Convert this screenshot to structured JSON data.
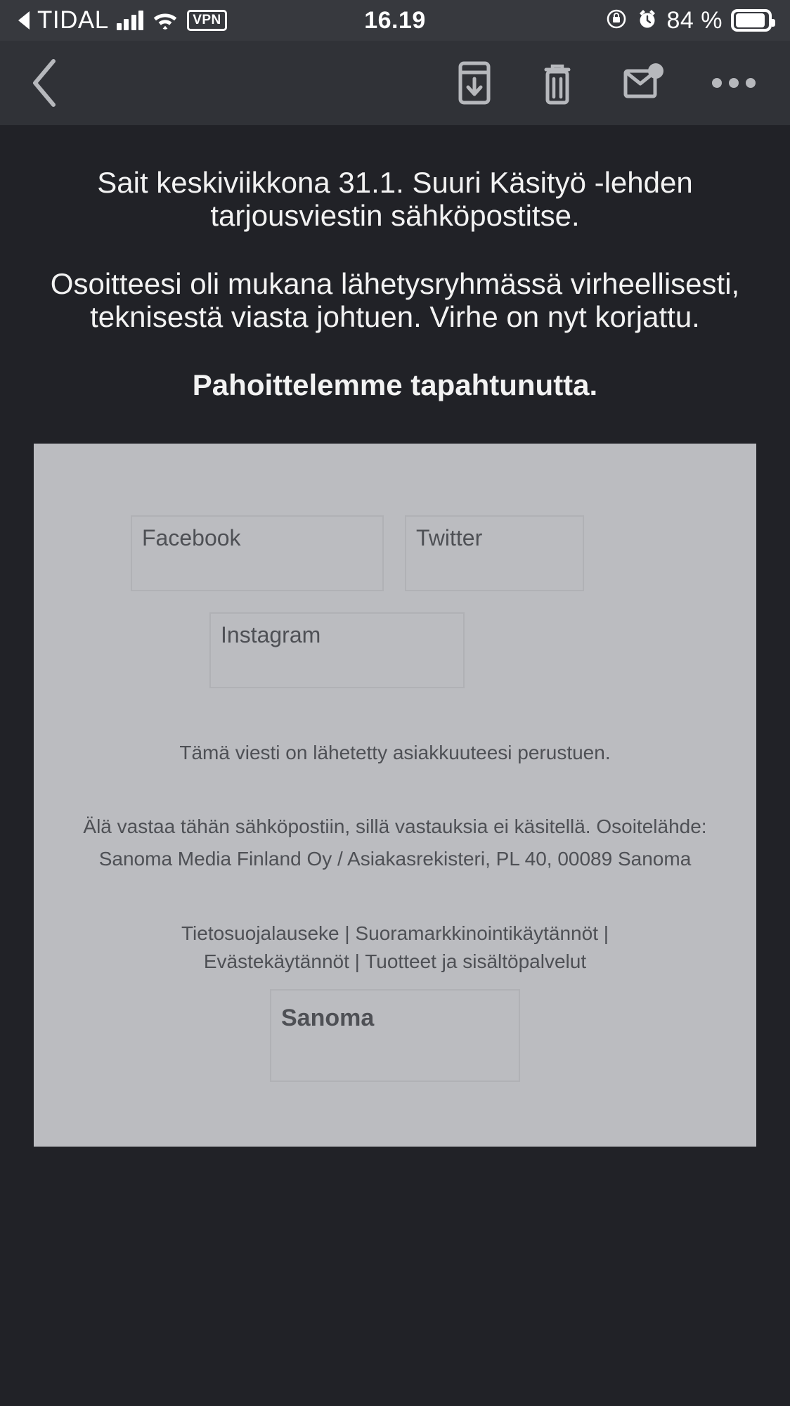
{
  "status_bar": {
    "back_indicator": "◀",
    "carrier": "TIDAL",
    "signal_icon": "signal-bars-icon",
    "wifi_icon": "wifi-icon",
    "vpn_label": "VPN",
    "time": "16.19",
    "rotation_lock_icon": "rotation-lock-icon",
    "alarm_icon": "alarm-clock-icon",
    "battery_percent": "84 %",
    "battery_icon": "battery-icon"
  },
  "toolbar": {
    "back_label": "back-chevron",
    "archive_label": "archive-icon",
    "delete_label": "trash-icon",
    "mark_unread_label": "mark-unread-icon",
    "more_label": "more-options-icon"
  },
  "message": {
    "paragraph_1": "Sait keskiviikkona 31.1. Suuri Käsityö -lehden tarjousviestin sähköpostitse.",
    "paragraph_2": "Osoitteesi oli mukana lähetysryhmässä virheellisesti, teknisestä viasta johtuen. Virhe on nyt korjattu.",
    "paragraph_3": "Pahoittelemme tapahtunutta."
  },
  "footer": {
    "social": [
      {
        "alt": "Facebook"
      },
      {
        "alt": "Twitter"
      },
      {
        "alt": "Instagram"
      }
    ],
    "note": "Tämä viesti on lähetetty asiakkuuteesi perustuen.",
    "disclaimer": "Älä vastaa tähän sähköpostiin, sillä vastauksia ei käsitellä. Osoitelähde: Sanoma Media Finland Oy / Asiakasrekisteri, PL 40, 00089 Sanoma",
    "links_line_1": "Tietosuojalauseke | Suoramarkkinointikäytännöt |",
    "links_line_2": "Evästekäytännöt | Tuotteet ja sisältöpalvelut",
    "logo_alt": "Sanoma"
  },
  "colors": {
    "background": "#212227",
    "statusbar": "#37393e",
    "toolbar": "#303237",
    "panel": "#bbbcc0",
    "text_light": "#f2f2f2",
    "text_dark": "#4e5055",
    "icon": "#b6b8bc"
  }
}
